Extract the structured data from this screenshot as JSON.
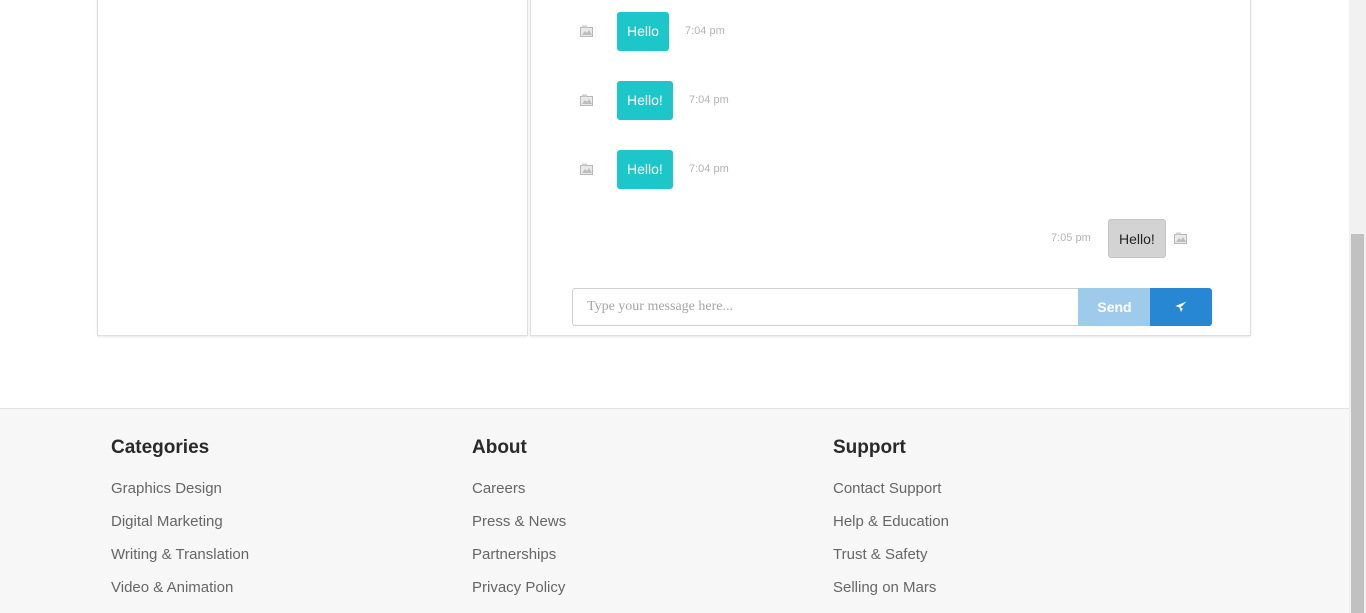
{
  "chat": {
    "messages": [
      {
        "direction": "in",
        "text": "Hello",
        "time": "7:04 pm"
      },
      {
        "direction": "in",
        "text": "Hello!",
        "time": "7:04 pm"
      },
      {
        "direction": "in",
        "text": "Hello!",
        "time": "7:04 pm"
      },
      {
        "direction": "out",
        "text": "Hello!",
        "time": "7:05 pm"
      }
    ],
    "avatar_icon": "broken-image-icon",
    "input_placeholder": "Type your message here...",
    "input_value": "",
    "send_label": "Send",
    "send_icon": "paper-plane-icon"
  },
  "footer": {
    "columns": [
      {
        "heading": "Categories",
        "links": [
          "Graphics Design",
          "Digital Marketing",
          "Writing & Translation",
          "Video & Animation"
        ]
      },
      {
        "heading": "About",
        "links": [
          "Careers",
          "Press & News",
          "Partnerships",
          "Privacy Policy"
        ]
      },
      {
        "heading": "Support",
        "links": [
          "Contact Support",
          "Help & Education",
          "Trust & Safety",
          "Selling on Mars"
        ]
      }
    ]
  },
  "colors": {
    "incoming_bubble": "#1cc6c9",
    "outgoing_bubble": "#d3d3d3",
    "send_button": "#9ecbec",
    "plane_button": "#2887d3",
    "footer_background": "#f7f7f7"
  }
}
